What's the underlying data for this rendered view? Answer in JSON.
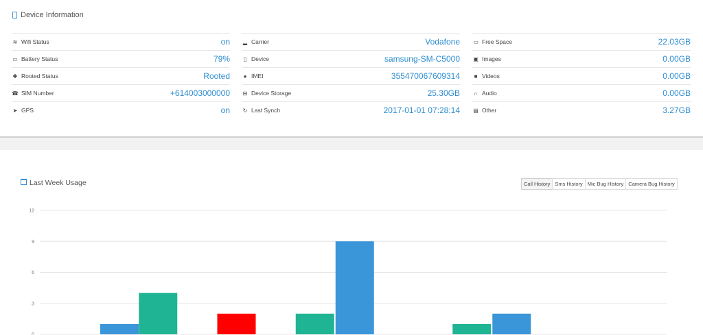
{
  "device_panel": {
    "title": "Device Information",
    "icon": "mobile-phone-icon",
    "columns": [
      [
        {
          "key": "wifi",
          "icon": "wifi-icon",
          "glyph": "≋",
          "label": "Wifi Status",
          "value": "on"
        },
        {
          "key": "battery",
          "icon": "battery-icon",
          "glyph": "▭",
          "label": "Battery Status",
          "value": "79%"
        },
        {
          "key": "rooted",
          "icon": "android-icon",
          "glyph": "✚",
          "label": "Rooted Status",
          "value": "Rooted"
        },
        {
          "key": "sim",
          "icon": "sim-card-icon",
          "glyph": "☎",
          "label": "SIM Number",
          "value": "+614003000000"
        },
        {
          "key": "gps",
          "icon": "location-arrow-icon",
          "glyph": "➤",
          "label": "GPS",
          "value": "on"
        }
      ],
      [
        {
          "key": "carrier",
          "icon": "signal-icon",
          "glyph": "▂",
          "label": "Carrier",
          "value": "Vodafone"
        },
        {
          "key": "device",
          "icon": "mobile-icon",
          "glyph": "▯",
          "label": "Device",
          "value": "samsung-SM-C5000"
        },
        {
          "key": "imei",
          "icon": "globe-icon",
          "glyph": "●",
          "label": "IMEI",
          "value": "355470067609314"
        },
        {
          "key": "storage",
          "icon": "hard-drive-icon",
          "glyph": "⊟",
          "label": "Device Storage",
          "value": "25.30GB"
        },
        {
          "key": "synch",
          "icon": "refresh-icon",
          "glyph": "↻",
          "label": "Last Synch",
          "value": "2017-01-01 07:28:14"
        }
      ],
      [
        {
          "key": "free",
          "icon": "folder-icon",
          "glyph": "▭",
          "label": "Free Space",
          "value": "22.03GB"
        },
        {
          "key": "images",
          "icon": "image-icon",
          "glyph": "▣",
          "label": "Images",
          "value": "0.00GB"
        },
        {
          "key": "videos",
          "icon": "video-camera-icon",
          "glyph": "■",
          "label": "Videos",
          "value": "0.00GB"
        },
        {
          "key": "audio",
          "icon": "headphones-icon",
          "glyph": "∩",
          "label": "Audio",
          "value": "0.00GB"
        },
        {
          "key": "other",
          "icon": "file-icon",
          "glyph": "▤",
          "label": "Other",
          "value": "3.27GB"
        }
      ]
    ]
  },
  "usage_panel": {
    "title": "Last Week Usage",
    "icon": "calendar-check-icon",
    "tabs": [
      {
        "label": "Call History",
        "active": true
      },
      {
        "label": "Sms History",
        "active": false
      },
      {
        "label": "Mic Bug History",
        "active": false
      },
      {
        "label": "Camera Bug History",
        "active": false
      }
    ]
  },
  "chart_data": {
    "type": "bar",
    "ylim": [
      0,
      12
    ],
    "yticks": [
      "0",
      "3",
      "6",
      "9",
      "12"
    ],
    "grid": true,
    "bars": [
      {
        "slot": 0,
        "sub": 1,
        "value": 1,
        "color": "#3a95d9"
      },
      {
        "slot": 1,
        "sub": 0,
        "value": 4,
        "color": "#1fb493"
      },
      {
        "slot": 2,
        "sub": 0,
        "value": 2,
        "color": "#ff0000"
      },
      {
        "slot": 3,
        "sub": 0,
        "value": 2,
        "color": "#1fb493"
      },
      {
        "slot": 3,
        "sub": 1,
        "value": 9,
        "color": "#3a95d9"
      },
      {
        "slot": 5,
        "sub": 0,
        "value": 1,
        "color": "#1fb493"
      },
      {
        "slot": 5,
        "sub": 1,
        "value": 2,
        "color": "#3a95d9"
      }
    ]
  }
}
